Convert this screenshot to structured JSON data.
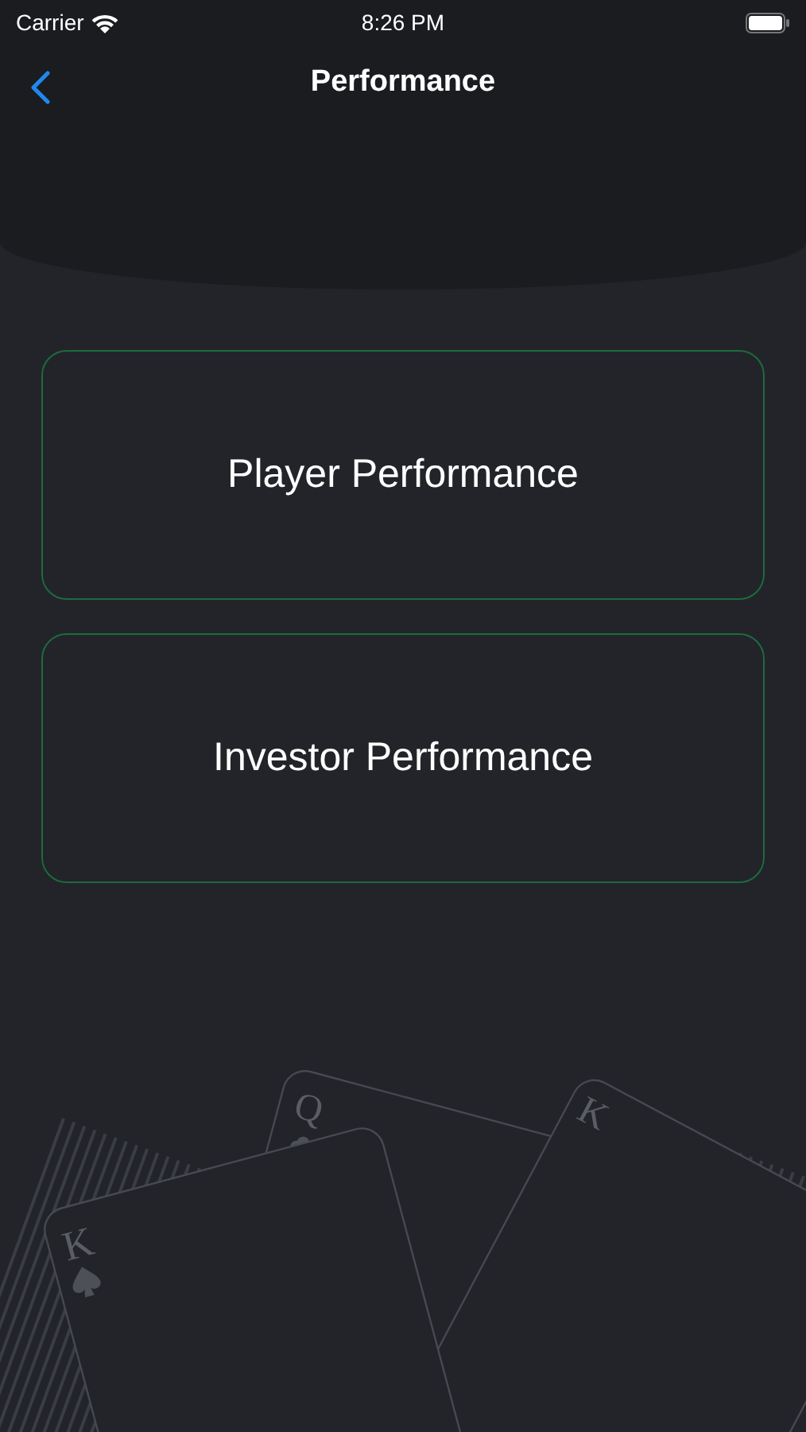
{
  "status_bar": {
    "carrier": "Carrier",
    "time": "8:26 PM"
  },
  "nav": {
    "title": "Performance"
  },
  "options": [
    {
      "label": "Player Performance"
    },
    {
      "label": "Investor Performance"
    }
  ],
  "card_ranks": [
    "Q",
    "K",
    "K"
  ]
}
